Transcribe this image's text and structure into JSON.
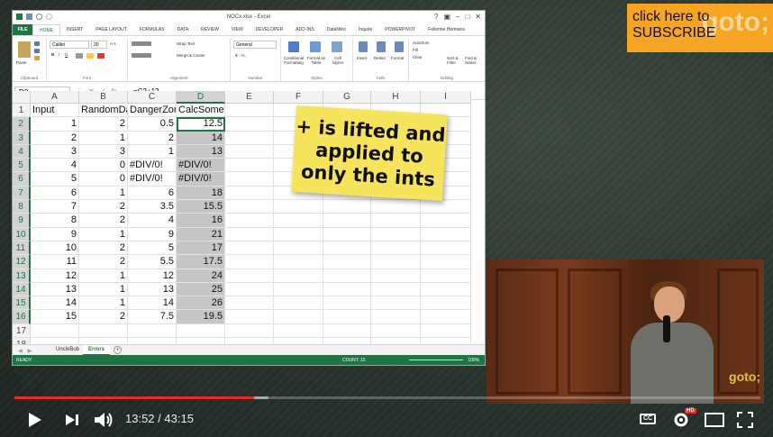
{
  "subscribe": {
    "line1": "click here to",
    "line2": "SUBSCRIBE",
    "brand": "goto;"
  },
  "excel": {
    "window_title": "NOCx.xlsx - Excel",
    "user": "Felienne Hermans",
    "tabs": [
      "FILE",
      "HOME",
      "INSERT",
      "PAGE LAYOUT",
      "FORMULAS",
      "DATA",
      "REVIEW",
      "VIEW",
      "DEVELOPER",
      "ADD-INS",
      "DataNitro",
      "Inquire",
      "POWERPIVOT"
    ],
    "ribbon": {
      "paste": "Paste",
      "font_name": "Calibri",
      "font_size": "20",
      "number_format": "General",
      "wrap_text": "Wrap Text",
      "merge_center": "Merge & Center",
      "conditional": "Conditional Formatting",
      "format_table": "Format as Table",
      "cell_styles": "Cell Styles",
      "insert": "Insert",
      "delete": "Delete",
      "format": "Format",
      "autosum": "AutoSum",
      "fill": "Fill",
      "clear": "Clear",
      "sort_filter": "Sort & Filter",
      "find_select": "Find & Select",
      "groups": [
        "Clipboard",
        "Font",
        "Alignment",
        "Number",
        "Styles",
        "Cells",
        "Editing"
      ]
    },
    "name_box": "D2",
    "formula": "=C2+12",
    "columns": [
      "A",
      "B",
      "C",
      "D",
      "E",
      "F",
      "G",
      "H",
      "I"
    ],
    "rows": [
      {
        "n": "1",
        "a": "Input",
        "b": "RandomDa",
        "c": "DangerZon",
        "d": "CalcSomeMore"
      },
      {
        "n": "2",
        "a": "1",
        "b": "2",
        "c": "0.5",
        "d": "12.5"
      },
      {
        "n": "3",
        "a": "2",
        "b": "1",
        "c": "2",
        "d": "14"
      },
      {
        "n": "4",
        "a": "3",
        "b": "3",
        "c": "1",
        "d": "13"
      },
      {
        "n": "5",
        "a": "4",
        "b": "0",
        "c": "#DIV/0!",
        "d": "#DIV/0!"
      },
      {
        "n": "6",
        "a": "5",
        "b": "0",
        "c": "#DIV/0!",
        "d": "#DIV/0!"
      },
      {
        "n": "7",
        "a": "6",
        "b": "1",
        "c": "6",
        "d": "18"
      },
      {
        "n": "8",
        "a": "7",
        "b": "2",
        "c": "3.5",
        "d": "15.5"
      },
      {
        "n": "9",
        "a": "8",
        "b": "2",
        "c": "4",
        "d": "16"
      },
      {
        "n": "10",
        "a": "9",
        "b": "1",
        "c": "9",
        "d": "21"
      },
      {
        "n": "11",
        "a": "10",
        "b": "2",
        "c": "5",
        "d": "17"
      },
      {
        "n": "12",
        "a": "11",
        "b": "2",
        "c": "5.5",
        "d": "17.5"
      },
      {
        "n": "13",
        "a": "12",
        "b": "1",
        "c": "12",
        "d": "24"
      },
      {
        "n": "14",
        "a": "13",
        "b": "1",
        "c": "13",
        "d": "25"
      },
      {
        "n": "15",
        "a": "14",
        "b": "1",
        "c": "14",
        "d": "26"
      },
      {
        "n": "16",
        "a": "15",
        "b": "2",
        "c": "7.5",
        "d": "19.5"
      },
      {
        "n": "17",
        "a": "",
        "b": "",
        "c": "",
        "d": ""
      },
      {
        "n": "18",
        "a": "",
        "b": "",
        "c": "",
        "d": ""
      }
    ],
    "sheets": [
      "UncleBob",
      "Errors"
    ],
    "status": {
      "ready": "READY",
      "count": "COUNT: 15",
      "zoom": "100%"
    }
  },
  "note": {
    "line1": "+ is lifted and",
    "line2": "applied to",
    "line3": "only the ints"
  },
  "speaker_logo": "goto;",
  "player": {
    "current_time": "13:52",
    "duration": "43:15",
    "progress_fraction": 0.321,
    "buffered_fraction": 0.34,
    "hd_badge": "HD",
    "cc_label": "CC"
  },
  "colors": {
    "excel_green": "#217346",
    "note_yellow": "#f6e45c",
    "subscribe_orange": "#f5a522",
    "progress_red": "#e52d27"
  }
}
